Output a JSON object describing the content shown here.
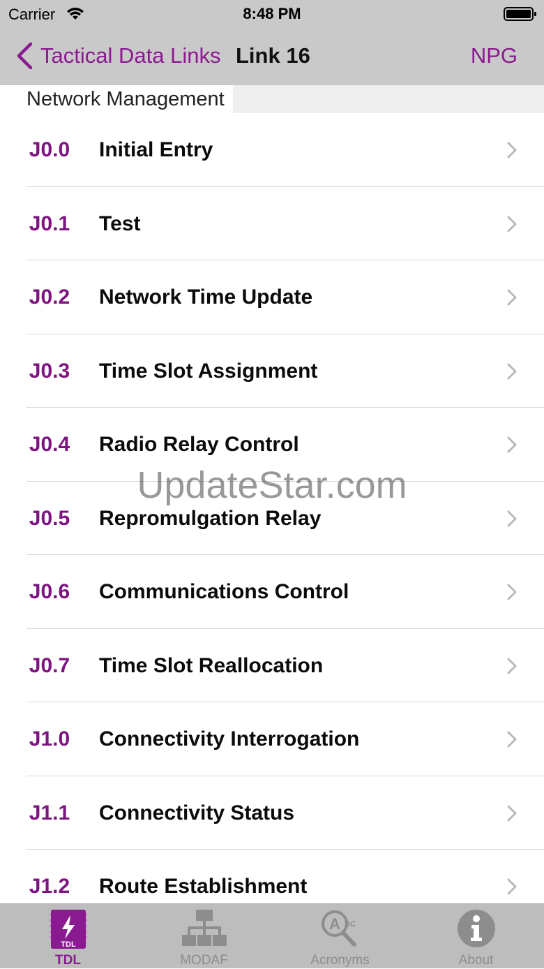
{
  "status": {
    "carrier": "Carrier",
    "time": "8:48 PM"
  },
  "nav": {
    "back_label": "Tactical Data Links",
    "title": "Link 16",
    "right_label": "NPG"
  },
  "section": {
    "title": "Network Management"
  },
  "rows": [
    {
      "code": "J0.0",
      "title": "Initial Entry"
    },
    {
      "code": "J0.1",
      "title": "Test"
    },
    {
      "code": "J0.2",
      "title": "Network Time Update"
    },
    {
      "code": "J0.3",
      "title": "Time Slot Assignment"
    },
    {
      "code": "J0.4",
      "title": "Radio Relay Control"
    },
    {
      "code": "J0.5",
      "title": "Repromulgation Relay"
    },
    {
      "code": "J0.6",
      "title": "Communications Control"
    },
    {
      "code": "J0.7",
      "title": "Time Slot Reallocation"
    },
    {
      "code": "J1.0",
      "title": "Connectivity Interrogation"
    },
    {
      "code": "J1.1",
      "title": "Connectivity Status"
    },
    {
      "code": "J1.2",
      "title": "Route Establishment"
    }
  ],
  "watermark": "UpdateStar.com",
  "tabs": [
    {
      "label": "TDL",
      "icon": "tdl-icon",
      "active": true
    },
    {
      "label": "MODAF",
      "icon": "network-diagram-icon",
      "active": false
    },
    {
      "label": "Acronyms",
      "icon": "magnifier-abc-icon",
      "active": false
    },
    {
      "label": "About",
      "icon": "info-icon",
      "active": false
    }
  ],
  "colors": {
    "accent": "#8a1a8f",
    "code": "#7d1480",
    "bar": "#c9c9c9",
    "tab_bar": "#bdbdbd",
    "inactive_tab": "#8d8d8d"
  }
}
